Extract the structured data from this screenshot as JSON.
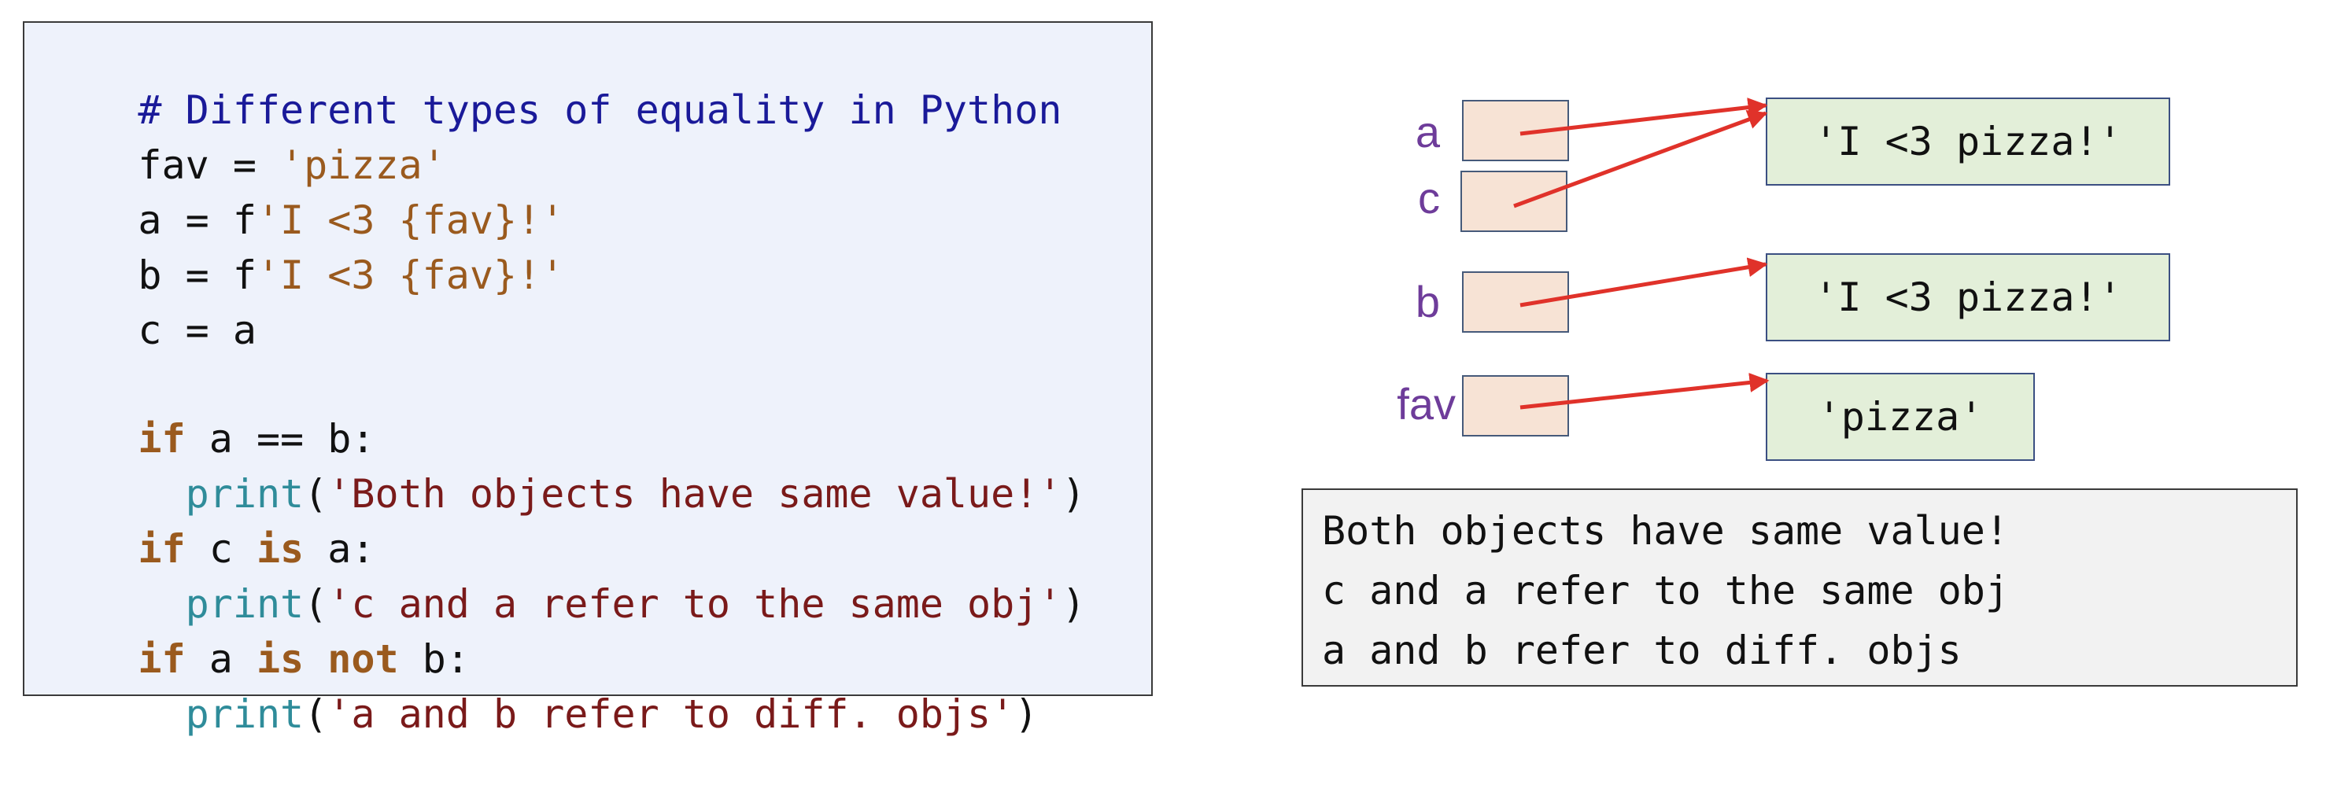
{
  "code": {
    "comment": "# Different types of equality in Python",
    "l2_a": "fav = ",
    "l2_b": "'pizza'",
    "l3_a": "a = f",
    "l3_b": "'I <3 {fav}!'",
    "l4_a": "b = f",
    "l4_b": "'I <3 {fav}!'",
    "l5": "c = a",
    "l7_kw": "if",
    "l7_rest": " a == b:",
    "l8_ind": "  ",
    "l8_fn": "print",
    "l8_open": "(",
    "l8_str": "'Both objects have same value!'",
    "l8_close": ")",
    "l9_kw1": "if",
    "l9_mid": " c ",
    "l9_kw2": "is",
    "l9_rest": " a:",
    "l10_ind": "  ",
    "l10_fn": "print",
    "l10_open": "(",
    "l10_str": "'c and a refer to the same obj'",
    "l10_close": ")",
    "l11_kw1": "if",
    "l11_mid": " a ",
    "l11_kw2": "is not",
    "l11_rest": " b:",
    "l12_ind": "  ",
    "l12_fn": "print",
    "l12_open": "(",
    "l12_str": "'a and b refer to diff. objs'",
    "l12_close": ")"
  },
  "diagram": {
    "vars": [
      {
        "name": "a"
      },
      {
        "name": "c"
      },
      {
        "name": "b"
      },
      {
        "name": "fav"
      }
    ],
    "objects": [
      {
        "value": "'I <3 pizza!'"
      },
      {
        "value": "'I <3 pizza!'"
      },
      {
        "value": "'pizza'"
      }
    ],
    "colors": {
      "arrow": "#e0322a",
      "var_label": "#6e3c9a",
      "var_box_fill": "#f7e3d5",
      "obj_box_fill": "#e3efd9",
      "code_bg": "#eef2fb"
    }
  },
  "output": {
    "lines": [
      "Both objects have same value!",
      "c and a refer to the same obj",
      "a and b refer to diff. objs"
    ]
  }
}
